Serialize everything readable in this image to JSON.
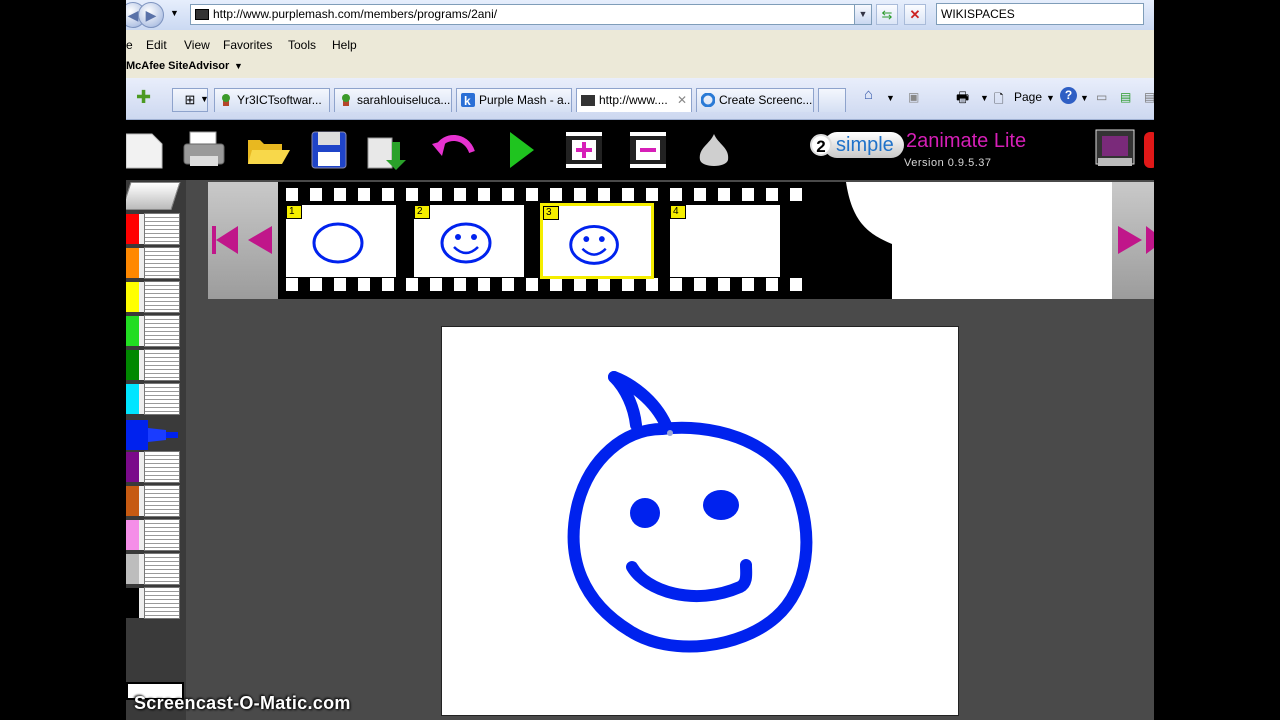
{
  "browser": {
    "address": "http://www.purplemash.com/members/programs/2ani/",
    "search_text": "WIKISPACES",
    "menu": [
      "e",
      "Edit",
      "View",
      "Favorites",
      "Tools",
      "Help"
    ],
    "siteadvisor": "McAfee SiteAdvisor",
    "tabs": [
      {
        "label": "Yr3ICTsoftwar..."
      },
      {
        "label": "sarahlouiseluca..."
      },
      {
        "label": "Purple Mash - a..."
      },
      {
        "label": "http://www...."
      },
      {
        "label": "Create Screenc..."
      }
    ],
    "page_label": "Page"
  },
  "app": {
    "brand_number": "2",
    "brand_word": "simple",
    "title": "2animate Lite",
    "version": "Version 0.9.5.37",
    "palette_colors": [
      "#ff0000",
      "#ff8800",
      "#ffff00",
      "#22dd22",
      "#008800",
      "#00e5ff",
      "#0033ff",
      "#7a0a8a",
      "#c65a12",
      "#f58ee8",
      "#bdbdbd",
      "#000000"
    ],
    "frames": [
      {
        "number": "1",
        "selected": false
      },
      {
        "number": "2",
        "selected": false
      },
      {
        "number": "3",
        "selected": true
      },
      {
        "number": "4",
        "selected": false
      }
    ],
    "drawing_color": "#0022ee"
  },
  "watermark": "Screencast-O-Matic.com"
}
